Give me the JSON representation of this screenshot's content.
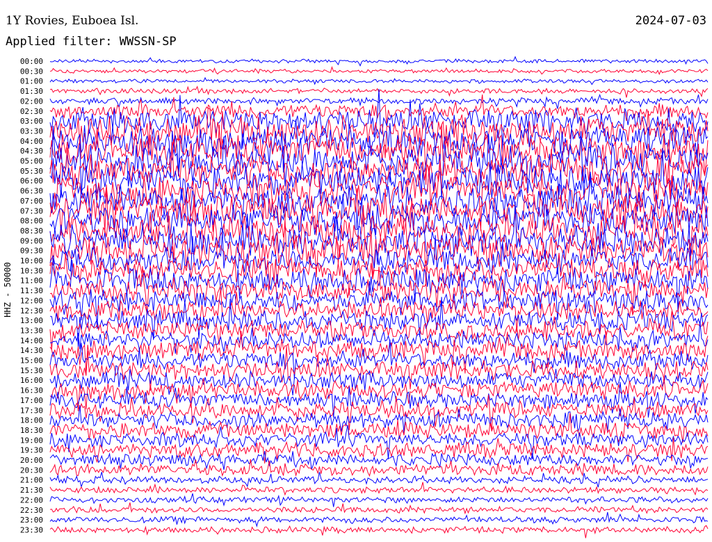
{
  "header": {
    "title": "1Y Rovies, Euboea Isl.",
    "filter": "Applied filter: WWSSN-SP",
    "date": "2024-07-03"
  },
  "chart_data": {
    "type": "line",
    "ylabel": "HHZ - 50000",
    "row_labels": [
      "00:00",
      "00:30",
      "01:00",
      "01:30",
      "02:00",
      "02:30",
      "03:00",
      "03:30",
      "04:00",
      "04:30",
      "05:00",
      "05:30",
      "06:00",
      "06:30",
      "07:00",
      "07:30",
      "08:00",
      "08:30",
      "09:00",
      "09:30",
      "10:00",
      "10:30",
      "11:00",
      "11:30",
      "12:00",
      "12:30",
      "13:00",
      "13:30",
      "14:00",
      "14:30",
      "15:00",
      "15:30",
      "16:00",
      "16:30",
      "17:00",
      "17:30",
      "18:00",
      "18:30",
      "19:00",
      "19:30",
      "20:00",
      "20:30",
      "21:00",
      "21:30",
      "22:00",
      "22:30",
      "23:00",
      "23:30"
    ],
    "trace_colors": [
      "#0000ff",
      "#ff0033"
    ],
    "trace_amplitude_levels": [
      0.3,
      0.3,
      0.3,
      0.4,
      0.5,
      1.2,
      2.0,
      2.5,
      2.5,
      2.5,
      2.5,
      2.5,
      2.5,
      2.5,
      2.5,
      2.5,
      2.5,
      2.5,
      2.5,
      2.5,
      2.0,
      2.0,
      2.0,
      1.8,
      1.8,
      1.6,
      1.6,
      1.5,
      1.5,
      1.5,
      1.5,
      1.5,
      1.4,
      1.4,
      1.3,
      1.3,
      1.3,
      1.3,
      1.2,
      1.2,
      1.0,
      1.0,
      0.6,
      0.5,
      0.5,
      0.5,
      0.5,
      0.5
    ]
  }
}
